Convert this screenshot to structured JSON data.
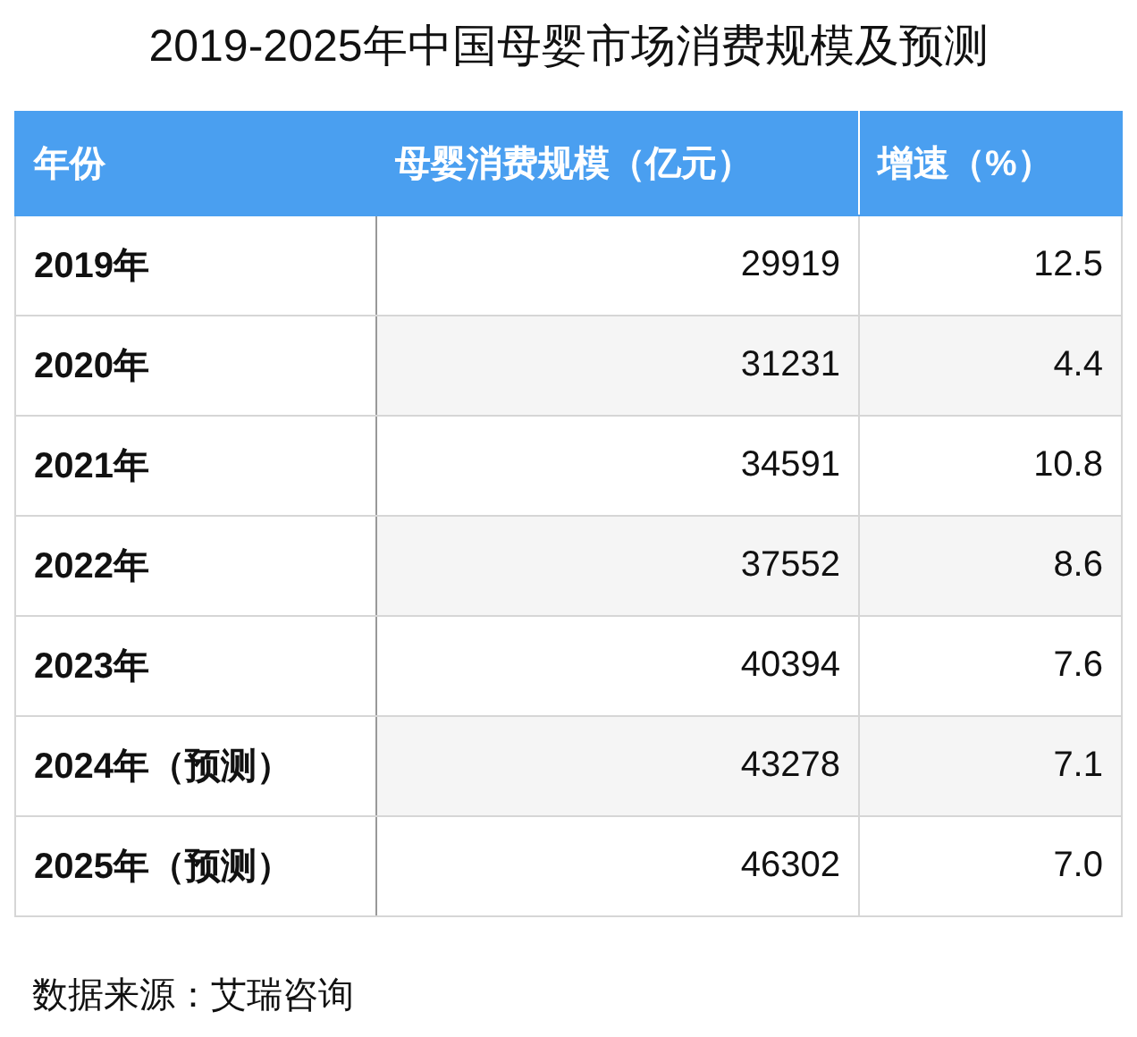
{
  "title": "2019-2025年中国母婴市场消费规模及预测",
  "table": {
    "columns": [
      "年份",
      "母婴消费规模（亿元）",
      "增速（%）"
    ],
    "rows": [
      {
        "year": "2019年",
        "scale": "29919",
        "growth": "12.5"
      },
      {
        "year": "2020年",
        "scale": "31231",
        "growth": "4.4"
      },
      {
        "year": "2021年",
        "scale": "34591",
        "growth": "10.8"
      },
      {
        "year": "2022年",
        "scale": "37552",
        "growth": "8.6"
      },
      {
        "year": "2023年",
        "scale": "40394",
        "growth": "7.6"
      },
      {
        "year": "2024年（预测）",
        "scale": "43278",
        "growth": "7.1"
      },
      {
        "year": "2025年（预测）",
        "scale": "46302",
        "growth": "7.0"
      }
    ]
  },
  "source": "数据来源：艾瑞咨询"
}
